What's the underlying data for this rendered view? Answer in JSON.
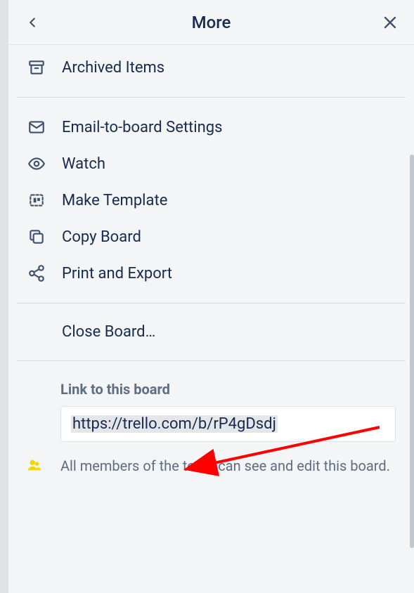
{
  "header": {
    "title": "More"
  },
  "items": {
    "archived": "Archived Items",
    "email": "Email-to-board Settings",
    "watch": "Watch",
    "template": "Make Template",
    "copy": "Copy Board",
    "print": "Print and Export",
    "close": "Close Board…"
  },
  "link": {
    "title": "Link to this board",
    "url": "https://trello.com/b/rP4gDsdj",
    "perm": "All members of the team can see and edit this board."
  }
}
